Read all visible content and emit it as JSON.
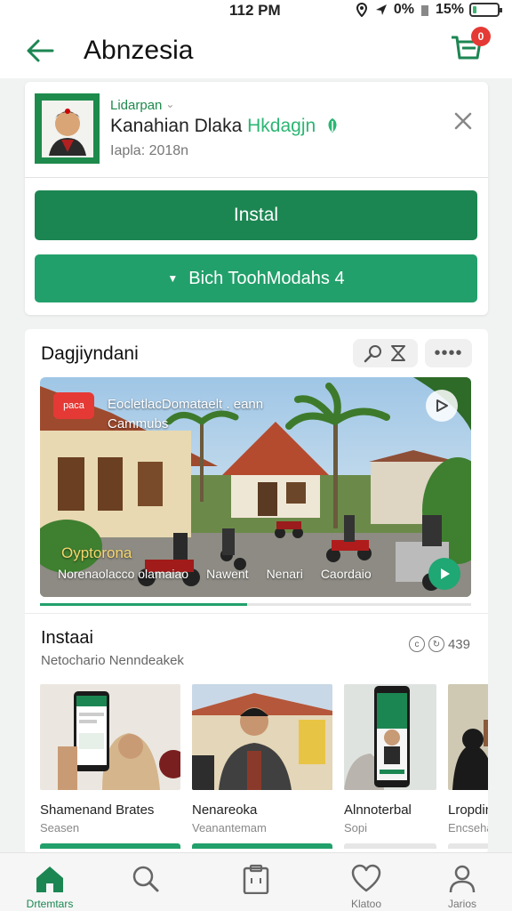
{
  "status": {
    "time": "112 PM",
    "battery": "15%",
    "signal": "0%"
  },
  "header": {
    "title": "Abnzesia",
    "cart_badge": "0"
  },
  "app": {
    "developer": "Lidarpan",
    "name_prefix": "Kanahian Dlaka",
    "name_accent": "Hkdagjn",
    "meta": "Iapla: 2018n",
    "install_label": "Instal",
    "secondary_label": "Bich ToohModahs 4"
  },
  "preview": {
    "title": "Dagjiyndani",
    "video": {
      "badge": "paca",
      "caption_line1": "EocletlacDomataelt . eann",
      "caption_line2": "Cammubs",
      "label": "Oyptorona",
      "subtitles": [
        "Norenaolacco olamaiao",
        "Nawent",
        "Nenari",
        "Caordaio"
      ],
      "progress": 0.48
    },
    "screens_title": "Instaai",
    "screens_sub": "Netochario Nenndeakek",
    "screens_count": "439",
    "thumbs": [
      {
        "title": "Shamenand  Brates",
        "sub": "Seasen"
      },
      {
        "title": "Nenareoka",
        "sub": "Veanantemam"
      },
      {
        "title": "Alnnoterbal",
        "sub": "Sopi"
      },
      {
        "title": "Lropdin",
        "sub": "Encsehas"
      }
    ]
  },
  "nav": [
    {
      "label": "Drtemtars"
    },
    {
      "label": ""
    },
    {
      "label": ""
    },
    {
      "label": "Klatoo"
    },
    {
      "label": "Jarios"
    }
  ],
  "colors": {
    "primary": "#1c8652",
    "accent": "#22a06b",
    "badge": "#e53935"
  }
}
